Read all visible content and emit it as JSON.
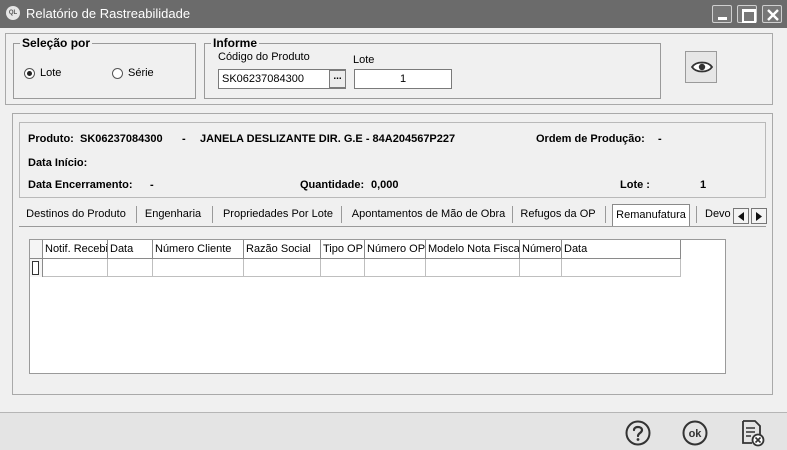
{
  "window": {
    "icon_text": "QL",
    "title": "Relatório de Rastreabilidade"
  },
  "selecao": {
    "title": "Seleção por",
    "lote_label": "Lote",
    "serie_label": "Série",
    "selected": "Lote"
  },
  "informe": {
    "title": "Informe",
    "codigo_label": "Código do Produto",
    "codigo_value": "SK06237084300",
    "lookup_label": "...",
    "lote_label": "Lote",
    "lote_value": "1"
  },
  "info": {
    "produto_label": "Produto:",
    "produto_codigo": "SK06237084300",
    "sep": "-",
    "produto_desc": "JANELA DESLIZANTE DIR. G.E - 84A204567P227",
    "ordem_label": "Ordem de Produção:",
    "ordem_value": "-",
    "data_inicio_label": "Data Início:",
    "data_encerramento_label": "Data Encerramento:",
    "data_encerramento_value": "-",
    "quantidade_label": "Quantidade:",
    "quantidade_value": "0,000",
    "lote_label": "Lote :",
    "lote_value": "1"
  },
  "tabs": [
    {
      "label": "Destinos do Produto"
    },
    {
      "label": "Engenharia"
    },
    {
      "label": "Propriedades Por Lote"
    },
    {
      "label": "Apontamentos de Mão de Obra"
    },
    {
      "label": "Refugos da OP"
    },
    {
      "label": "Remanufatura"
    },
    {
      "label": "Devo"
    }
  ],
  "active_tab": "Remanufatura",
  "grid": {
    "columns": [
      "Notif. Recebi",
      "Data",
      "Número Cliente",
      "Razão Social",
      "Tipo OP",
      "Número OP",
      "Modelo Nota Fiscal",
      "Número",
      "Data"
    ]
  },
  "toolbar": {
    "help": "help-icon",
    "ok": "ok",
    "cancel": "cancel-report-icon"
  },
  "colors": {
    "titlebar": "#6b6b6b",
    "background": "#f0f0f0"
  }
}
